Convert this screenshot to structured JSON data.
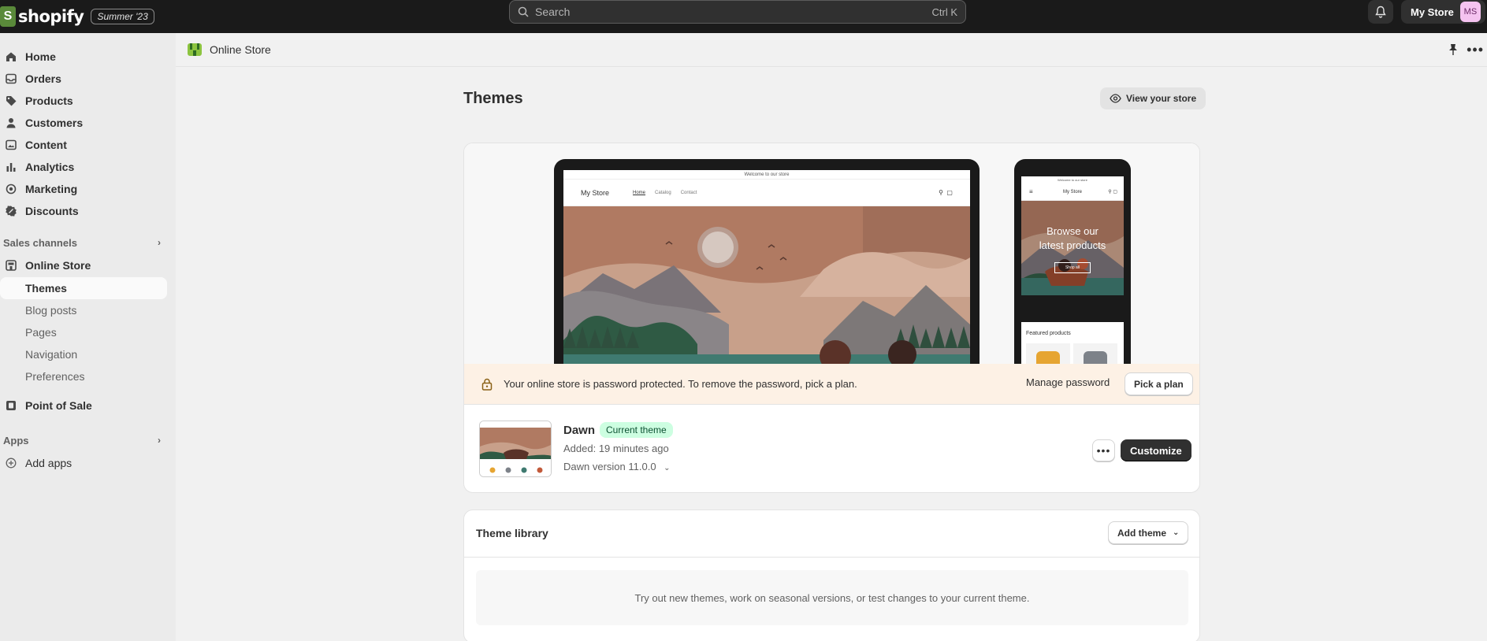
{
  "topbar": {
    "brand": "shopify",
    "edition": "Summer '23",
    "search_placeholder": "Search",
    "search_shortcut": "Ctrl K",
    "store_name": "My Store",
    "avatar_initials": "MS"
  },
  "sidebar": {
    "items": [
      {
        "label": "Home",
        "icon": "home-icon"
      },
      {
        "label": "Orders",
        "icon": "inbox-icon"
      },
      {
        "label": "Products",
        "icon": "tag-icon"
      },
      {
        "label": "Customers",
        "icon": "person-icon"
      },
      {
        "label": "Content",
        "icon": "content-icon"
      },
      {
        "label": "Analytics",
        "icon": "bar-chart-icon"
      },
      {
        "label": "Marketing",
        "icon": "target-icon"
      },
      {
        "label": "Discounts",
        "icon": "discount-icon"
      }
    ],
    "sales_channels_label": "Sales channels",
    "online_store": "Online Store",
    "online_store_sub": [
      "Themes",
      "Blog posts",
      "Pages",
      "Navigation",
      "Preferences"
    ],
    "point_of_sale": "Point of Sale",
    "apps_label": "Apps",
    "add_apps": "Add apps"
  },
  "subheader": {
    "title": "Online Store"
  },
  "page": {
    "title": "Themes",
    "view_store": "View your store"
  },
  "preview": {
    "laptop_announcement": "Welcome to our store",
    "laptop_store": "My Store",
    "laptop_links": [
      "Home",
      "Catalog",
      "Contact"
    ],
    "phone_announcement": "Welcome to our store",
    "phone_store": "My Store",
    "phone_hero_line1": "Browse our",
    "phone_hero_line2": "latest products",
    "phone_shop_all": "Shop all",
    "phone_featured": "Featured products"
  },
  "banner": {
    "message": "Your online store is password protected. To remove the password, pick a plan.",
    "manage": "Manage password",
    "pick": "Pick a plan"
  },
  "current_theme": {
    "name": "Dawn",
    "badge": "Current theme",
    "added": "Added: 19 minutes ago",
    "version": "Dawn version 11.0.0",
    "customize": "Customize"
  },
  "library": {
    "title": "Theme library",
    "add_theme": "Add theme",
    "empty_text": "Try out new themes, work on seasonal versions, or test changes to your current theme."
  }
}
